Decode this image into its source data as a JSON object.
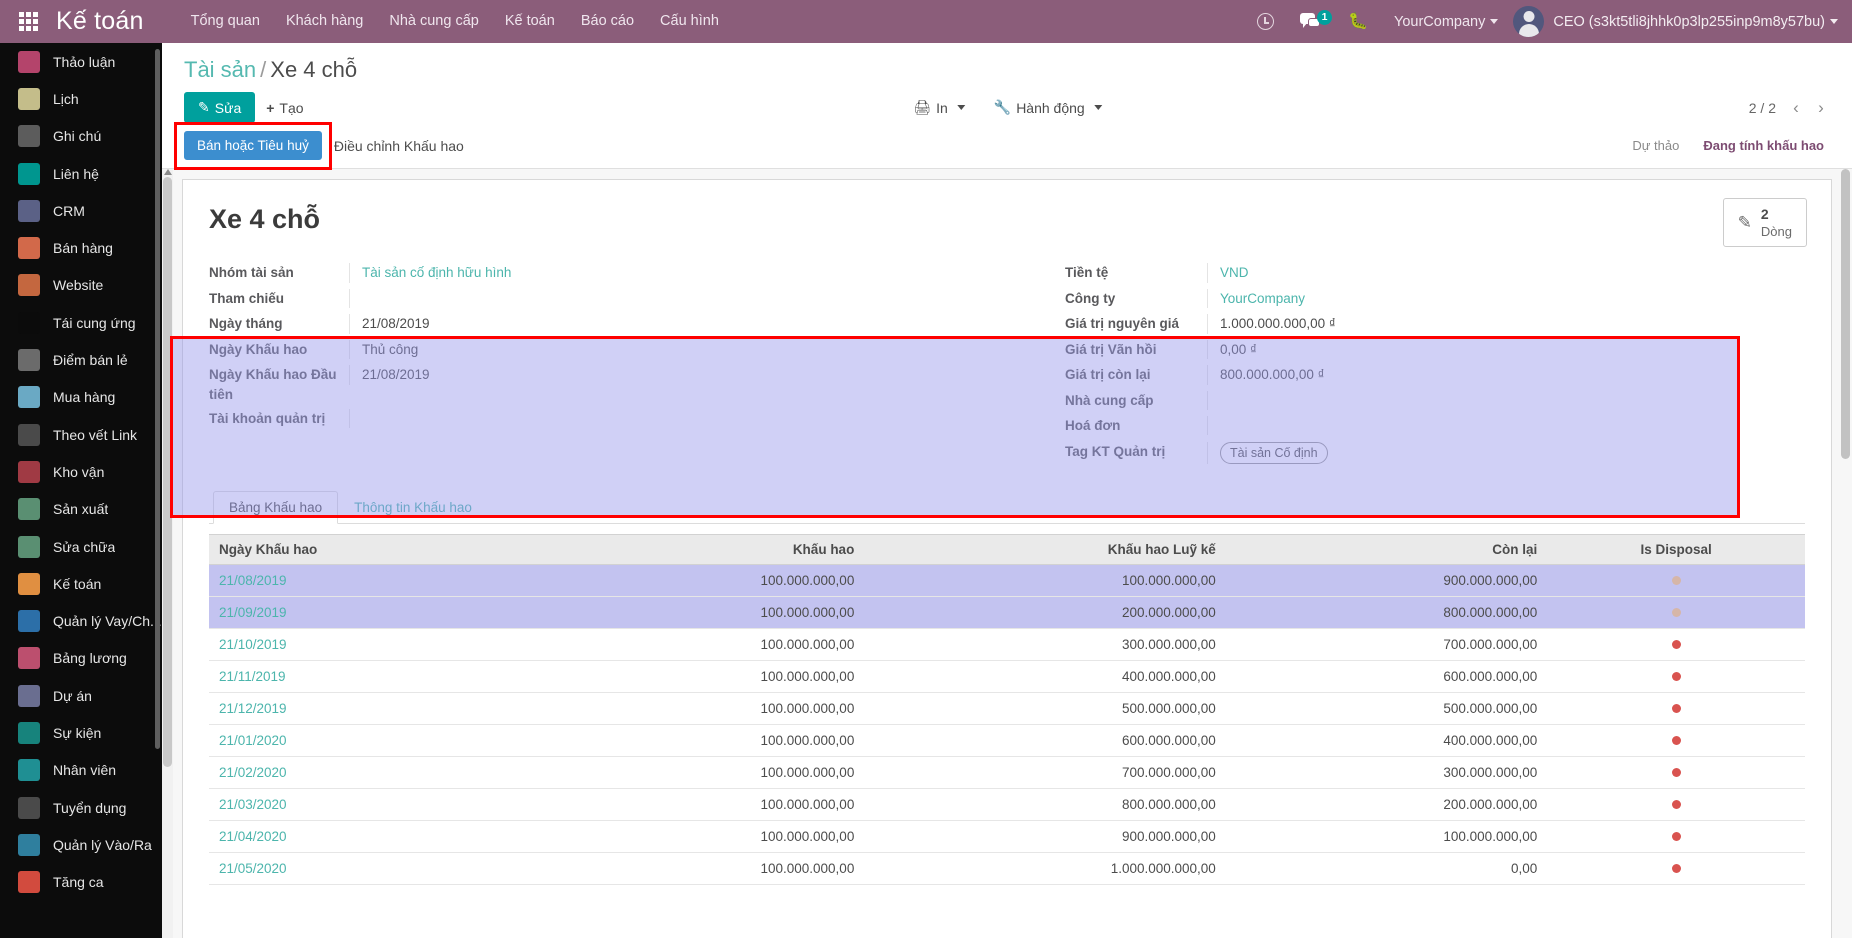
{
  "topbar": {
    "apps_icon": "apps-grid-icon",
    "brand": "Kế toán",
    "menu": [
      "Tổng quan",
      "Khách hàng",
      "Nhà cung cấp",
      "Kế toán",
      "Báo cáo",
      "Cấu hình"
    ],
    "activity_icon": "clock-icon",
    "messages_icon": "chat-icon",
    "messages_count": "1",
    "debug_icon": "bug-icon",
    "company": "YourCompany",
    "avatar_icon": "user-avatar",
    "username": "CEO (s3kt5tli8jhhk0p3lp255inp9m8y57bu)"
  },
  "sidebar": {
    "items": [
      {
        "label": "Thảo luận",
        "icon": "chat-bubble-icon",
        "color": "#b4446b"
      },
      {
        "label": "Lịch",
        "icon": "calendar-icon",
        "color": "#c4bd8a"
      },
      {
        "label": "Ghi chú",
        "icon": "note-edit-icon",
        "color": "#5c5c5c"
      },
      {
        "label": "Liên hệ",
        "icon": "contact-card-icon",
        "color": "#00968f"
      },
      {
        "label": "CRM",
        "icon": "handshake-icon",
        "color": "#5b6186"
      },
      {
        "label": "Bán hàng",
        "icon": "chart-up-icon",
        "color": "#d2694a"
      },
      {
        "label": "Website",
        "icon": "globe-icon",
        "color": "#c4673f"
      },
      {
        "label": "Tái cung ứng",
        "icon": "lifebuoy-icon",
        "color": "#0b0b0b"
      },
      {
        "label": "Điểm bán lẻ",
        "icon": "shop-icon",
        "color": "#6b6b6b"
      },
      {
        "label": "Mua hàng",
        "icon": "credit-card-icon",
        "color": "#6aa9c4"
      },
      {
        "label": "Theo vết Link",
        "icon": "link-icon",
        "color": "#4a4a4a"
      },
      {
        "label": "Kho vận",
        "icon": "boxes-icon",
        "color": "#a03a44"
      },
      {
        "label": "Sản xuất",
        "icon": "wrench-icon",
        "color": "#5a8f72"
      },
      {
        "label": "Sửa chữa",
        "icon": "repair-icon",
        "color": "#5a8f72"
      },
      {
        "label": "Kế toán",
        "icon": "document-icon",
        "color": "#e08f41"
      },
      {
        "label": "Quản lý Vay/Ch...",
        "icon": "money-bag-icon",
        "color": "#2c6fa8"
      },
      {
        "label": "Bảng lương",
        "icon": "payroll-icon",
        "color": "#bc4f6e"
      },
      {
        "label": "Dự án",
        "icon": "puzzle-icon",
        "color": "#6a6e90"
      },
      {
        "label": "Sự kiện",
        "icon": "ticket-icon",
        "color": "#17837c"
      },
      {
        "label": "Nhân viên",
        "icon": "people-icon",
        "color": "#1f8f93"
      },
      {
        "label": "Tuyển dụng",
        "icon": "magnifier-icon",
        "color": "#4a4a4a"
      },
      {
        "label": "Quản lý Vào/Ra",
        "icon": "attendance-icon",
        "color": "#2f7f9e"
      },
      {
        "label": "Tăng ca",
        "icon": "overtime-icon",
        "color": "#d24b3e"
      }
    ]
  },
  "controlpanel": {
    "breadcrumb_root": "Tài sản",
    "breadcrumb_sep": "/",
    "breadcrumb_current": "Xe 4 chỗ",
    "edit_button": "Sửa",
    "edit_icon": "pencil-icon",
    "create_button": "Tạo",
    "create_icon": "plus-icon",
    "print_button": "In",
    "print_icon": "printer-icon",
    "action_button": "Hành động",
    "action_icon": "wrench-icon",
    "pager_value": "2 / 2",
    "pager_prev_icon": "chevron-left-icon",
    "pager_next_icon": "chevron-right-icon"
  },
  "statusbar": {
    "sell_or_dispose_button": "Bán hoặc Tiêu huỷ",
    "adjust_depreciation_button": "Điều chỉnh Khấu hao",
    "stages": [
      "Dự thảo",
      "Đang tính khấu hao"
    ],
    "active_stage": "Đang tính khấu hao"
  },
  "sheet": {
    "title": "Xe 4 chỗ",
    "stat_button": {
      "icon": "pencil-icon",
      "value": "2",
      "label": "Dòng"
    },
    "left_fields": [
      {
        "label": "Nhóm tài sản",
        "value": "Tài sản cố định hữu hình",
        "link": true
      },
      {
        "label": "Tham chiếu",
        "value": "",
        "link": false
      },
      {
        "label": "Ngày tháng",
        "value": "21/08/2019",
        "link": false
      },
      {
        "label": "Ngày Khấu hao",
        "value": "Thủ công",
        "link": false
      },
      {
        "label": "Ngày Khấu hao Đầu tiên",
        "value": "21/08/2019",
        "link": false
      },
      {
        "label": "Tài khoản quản trị",
        "value": "",
        "link": false
      }
    ],
    "right_fields": [
      {
        "label": "Tiền tệ",
        "value": "VND",
        "link": true
      },
      {
        "label": "Công ty",
        "value": "YourCompany",
        "link": true
      },
      {
        "label": "Giá trị nguyên giá",
        "value": "1.000.000.000,00 ₫",
        "link": false
      },
      {
        "label": "Giá trị Vãn hồi",
        "value": "0,00 ₫",
        "link": false
      },
      {
        "label": "Giá trị còn lại",
        "value": "800.000.000,00 ₫",
        "link": false
      },
      {
        "label": "Nhà cung cấp",
        "value": "",
        "link": false
      },
      {
        "label": "Hoá đơn",
        "value": "",
        "link": false
      },
      {
        "label": "Tag KT Quản trị",
        "value": "Tài sản Cố định",
        "tag": true
      }
    ]
  },
  "notebook": {
    "tabs": [
      {
        "label": "Bảng Khấu hao",
        "active": true
      },
      {
        "label": "Thông tin Khấu hao",
        "active": false
      }
    ],
    "table": {
      "columns": [
        "Ngày Khấu hao",
        "Khấu hao",
        "Khấu hao Luỹ kế",
        "Còn lại",
        "Is Disposal"
      ],
      "rows": [
        {
          "date": "21/08/2019",
          "depreciation": "100.000.000,00",
          "cumulative": "100.000.000,00",
          "remaining": "900.000.000,00",
          "disposal": "muted",
          "highlight": true
        },
        {
          "date": "21/09/2019",
          "depreciation": "100.000.000,00",
          "cumulative": "200.000.000,00",
          "remaining": "800.000.000,00",
          "disposal": "muted",
          "highlight": true
        },
        {
          "date": "21/10/2019",
          "depreciation": "100.000.000,00",
          "cumulative": "300.000.000,00",
          "remaining": "700.000.000,00",
          "disposal": "red",
          "highlight": false
        },
        {
          "date": "21/11/2019",
          "depreciation": "100.000.000,00",
          "cumulative": "400.000.000,00",
          "remaining": "600.000.000,00",
          "disposal": "red",
          "highlight": false
        },
        {
          "date": "21/12/2019",
          "depreciation": "100.000.000,00",
          "cumulative": "500.000.000,00",
          "remaining": "500.000.000,00",
          "disposal": "red",
          "highlight": false
        },
        {
          "date": "21/01/2020",
          "depreciation": "100.000.000,00",
          "cumulative": "600.000.000,00",
          "remaining": "400.000.000,00",
          "disposal": "red",
          "highlight": false
        },
        {
          "date": "21/02/2020",
          "depreciation": "100.000.000,00",
          "cumulative": "700.000.000,00",
          "remaining": "300.000.000,00",
          "disposal": "red",
          "highlight": false
        },
        {
          "date": "21/03/2020",
          "depreciation": "100.000.000,00",
          "cumulative": "800.000.000,00",
          "remaining": "200.000.000,00",
          "disposal": "red",
          "highlight": false
        },
        {
          "date": "21/04/2020",
          "depreciation": "100.000.000,00",
          "cumulative": "900.000.000,00",
          "remaining": "100.000.000,00",
          "disposal": "red",
          "highlight": false
        },
        {
          "date": "21/05/2020",
          "depreciation": "100.000.000,00",
          "cumulative": "1.000.000.000,00",
          "remaining": "0,00",
          "disposal": "red",
          "highlight": false
        }
      ]
    }
  }
}
